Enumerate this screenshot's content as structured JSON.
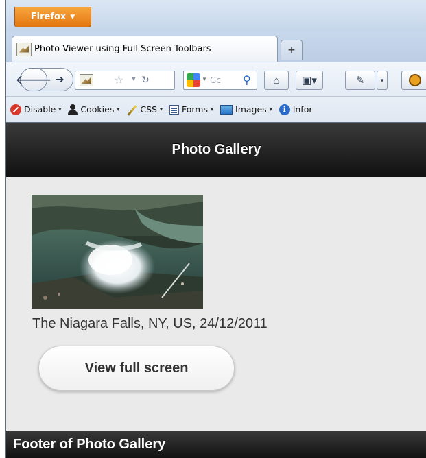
{
  "browser": {
    "menu_button": "Firefox",
    "tab_title": "Photo Viewer using Full Screen Toolbars",
    "new_tab": "+",
    "search_placeholder": "Gc"
  },
  "devbar": {
    "items": [
      {
        "label": "Disable",
        "icon": "disable-icon"
      },
      {
        "label": "Cookies",
        "icon": "cookies-icon"
      },
      {
        "label": "CSS",
        "icon": "css-icon"
      },
      {
        "label": "Forms",
        "icon": "forms-icon"
      },
      {
        "label": "Images",
        "icon": "images-icon"
      },
      {
        "label": "Infor",
        "icon": "information-icon"
      }
    ]
  },
  "page": {
    "header_title": "Photo Gallery",
    "photo_caption": "The Niagara Falls, NY, US, 24/12/2011",
    "view_button": "View full screen",
    "footer_title": "Footer of Photo Gallery"
  },
  "colors": {
    "firefox_orange": "#e3760e",
    "header_bg": "#111111",
    "page_bg": "#eaeaea"
  }
}
